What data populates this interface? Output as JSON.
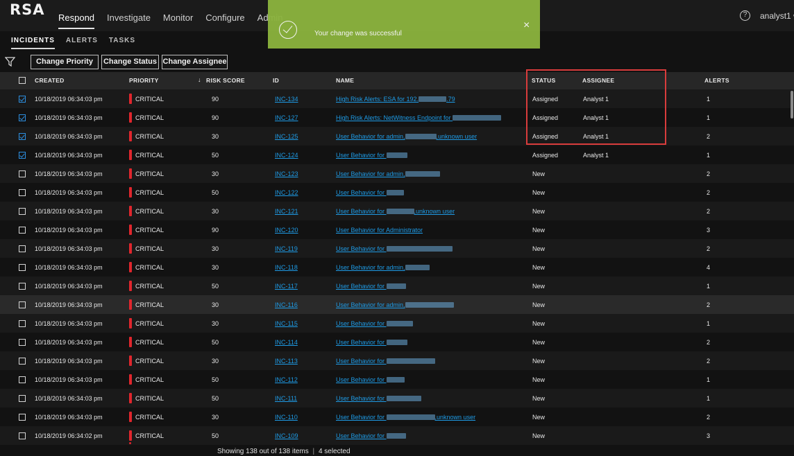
{
  "app": {
    "logo": "RSA",
    "nav": [
      {
        "label": "Respond",
        "active": true
      },
      {
        "label": "Investigate",
        "active": false
      },
      {
        "label": "Monitor",
        "active": false
      },
      {
        "label": "Configure",
        "active": false
      },
      {
        "label": "Admin",
        "active": false
      }
    ],
    "help_icon": "?",
    "user": "analyst1",
    "user_chevron": "∨"
  },
  "subnav": [
    {
      "label": "INCIDENTS",
      "active": true
    },
    {
      "label": "ALERTS",
      "active": false
    },
    {
      "label": "TASKS",
      "active": false
    }
  ],
  "toolbar": {
    "change_priority": "Change Priority",
    "change_status": "Change Status",
    "change_assignee": "Change Assignee"
  },
  "toast": {
    "message": "Your change was successful",
    "close": "×",
    "color": "#8cb43e"
  },
  "table": {
    "columns": {
      "created": "CREATED",
      "priority": "PRIORITY",
      "sort_arrow": "↓",
      "risk_score": "RISK SCORE",
      "id": "ID",
      "name": "NAME",
      "status": "STATUS",
      "assignee": "ASSIGNEE",
      "alerts": "ALERTS"
    },
    "rows": [
      {
        "checked": true,
        "created": "10/18/2019 06:34:03 pm",
        "priority": "CRITICAL",
        "risk": "90",
        "id": "INC-134",
        "name_pre": "High Risk Alerts: ESA for 192.",
        "name_post": ".79",
        "status": "Assigned",
        "assignee": "Analyst 1",
        "alerts": "1"
      },
      {
        "checked": true,
        "created": "10/18/2019 06:34:03 pm",
        "priority": "CRITICAL",
        "risk": "90",
        "id": "INC-127",
        "name_pre": "High Risk Alerts: NetWitness Endpoint for ",
        "name_post": "",
        "status": "Assigned",
        "assignee": "Analyst 1",
        "alerts": "1"
      },
      {
        "checked": true,
        "created": "10/18/2019 06:34:03 pm",
        "priority": "CRITICAL",
        "risk": "30",
        "id": "INC-125",
        "name_pre": "User Behavior for admin,",
        "name_post": ",unknown user",
        "status": "Assigned",
        "assignee": "Analyst 1",
        "alerts": "2"
      },
      {
        "checked": true,
        "created": "10/18/2019 06:34:03 pm",
        "priority": "CRITICAL",
        "risk": "50",
        "id": "INC-124",
        "name_pre": "User Behavior for ",
        "name_post": "",
        "status": "Assigned",
        "assignee": "Analyst 1",
        "alerts": "1"
      },
      {
        "checked": false,
        "created": "10/18/2019 06:34:03 pm",
        "priority": "CRITICAL",
        "risk": "30",
        "id": "INC-123",
        "name_pre": "User Behavior for admin,",
        "name_post": "",
        "status": "New",
        "assignee": "",
        "alerts": "2"
      },
      {
        "checked": false,
        "created": "10/18/2019 06:34:03 pm",
        "priority": "CRITICAL",
        "risk": "50",
        "id": "INC-122",
        "name_pre": "User Behavior for ",
        "name_post": "",
        "status": "New",
        "assignee": "",
        "alerts": "2"
      },
      {
        "checked": false,
        "created": "10/18/2019 06:34:03 pm",
        "priority": "CRITICAL",
        "risk": "30",
        "id": "INC-121",
        "name_pre": "User Behavior for ",
        "name_post": ",unknown user",
        "status": "New",
        "assignee": "",
        "alerts": "2"
      },
      {
        "checked": false,
        "created": "10/18/2019 06:34:03 pm",
        "priority": "CRITICAL",
        "risk": "90",
        "id": "INC-120",
        "name_pre": "User Behavior for Administrator",
        "name_post": "",
        "status": "New",
        "assignee": "",
        "alerts": "3"
      },
      {
        "checked": false,
        "created": "10/18/2019 06:34:03 pm",
        "priority": "CRITICAL",
        "risk": "30",
        "id": "INC-119",
        "name_pre": "User Behavior for ",
        "name_post": "",
        "status": "New",
        "assignee": "",
        "alerts": "2"
      },
      {
        "checked": false,
        "created": "10/18/2019 06:34:03 pm",
        "priority": "CRITICAL",
        "risk": "30",
        "id": "INC-118",
        "name_pre": "User Behavior for admin,",
        "name_post": "",
        "status": "New",
        "assignee": "",
        "alerts": "4"
      },
      {
        "checked": false,
        "created": "10/18/2019 06:34:03 pm",
        "priority": "CRITICAL",
        "risk": "50",
        "id": "INC-117",
        "name_pre": "User Behavior for ",
        "name_post": "",
        "status": "New",
        "assignee": "",
        "alerts": "1"
      },
      {
        "checked": false,
        "created": "10/18/2019 06:34:03 pm",
        "priority": "CRITICAL",
        "risk": "30",
        "id": "INC-116",
        "name_pre": "User Behavior for admin,",
        "name_post": "",
        "status": "New",
        "assignee": "",
        "alerts": "2"
      },
      {
        "checked": false,
        "created": "10/18/2019 06:34:03 pm",
        "priority": "CRITICAL",
        "risk": "30",
        "id": "INC-115",
        "name_pre": "User Behavior for ",
        "name_post": "",
        "status": "New",
        "assignee": "",
        "alerts": "1"
      },
      {
        "checked": false,
        "created": "10/18/2019 06:34:03 pm",
        "priority": "CRITICAL",
        "risk": "50",
        "id": "INC-114",
        "name_pre": "User Behavior for ",
        "name_post": "",
        "status": "New",
        "assignee": "",
        "alerts": "2"
      },
      {
        "checked": false,
        "created": "10/18/2019 06:34:03 pm",
        "priority": "CRITICAL",
        "risk": "30",
        "id": "INC-113",
        "name_pre": "User Behavior for ",
        "name_post": "",
        "status": "New",
        "assignee": "",
        "alerts": "2"
      },
      {
        "checked": false,
        "created": "10/18/2019 06:34:03 pm",
        "priority": "CRITICAL",
        "risk": "50",
        "id": "INC-112",
        "name_pre": "User Behavior for ",
        "name_post": "",
        "status": "New",
        "assignee": "",
        "alerts": "1"
      },
      {
        "checked": false,
        "created": "10/18/2019 06:34:03 pm",
        "priority": "CRITICAL",
        "risk": "50",
        "id": "INC-111",
        "name_pre": "User Behavior for ",
        "name_post": "",
        "status": "New",
        "assignee": "",
        "alerts": "1"
      },
      {
        "checked": false,
        "created": "10/18/2019 06:34:03 pm",
        "priority": "CRITICAL",
        "risk": "30",
        "id": "INC-110",
        "name_pre": "User Behavior for ",
        "name_post": ",unknown user",
        "status": "New",
        "assignee": "",
        "alerts": "2"
      },
      {
        "checked": false,
        "created": "10/18/2019 06:34:02 pm",
        "priority": "CRITICAL",
        "risk": "50",
        "id": "INC-109",
        "name_pre": "User Behavior for ",
        "name_post": "",
        "status": "New",
        "assignee": "",
        "alerts": "3"
      }
    ]
  },
  "footer": {
    "showing": "Showing 138 out of 138 items",
    "separator": "|",
    "selected": "4 selected"
  },
  "colors": {
    "priority_critical": "#e0262d",
    "link": "#1e9be6",
    "highlight_box": "#d93c3c"
  }
}
